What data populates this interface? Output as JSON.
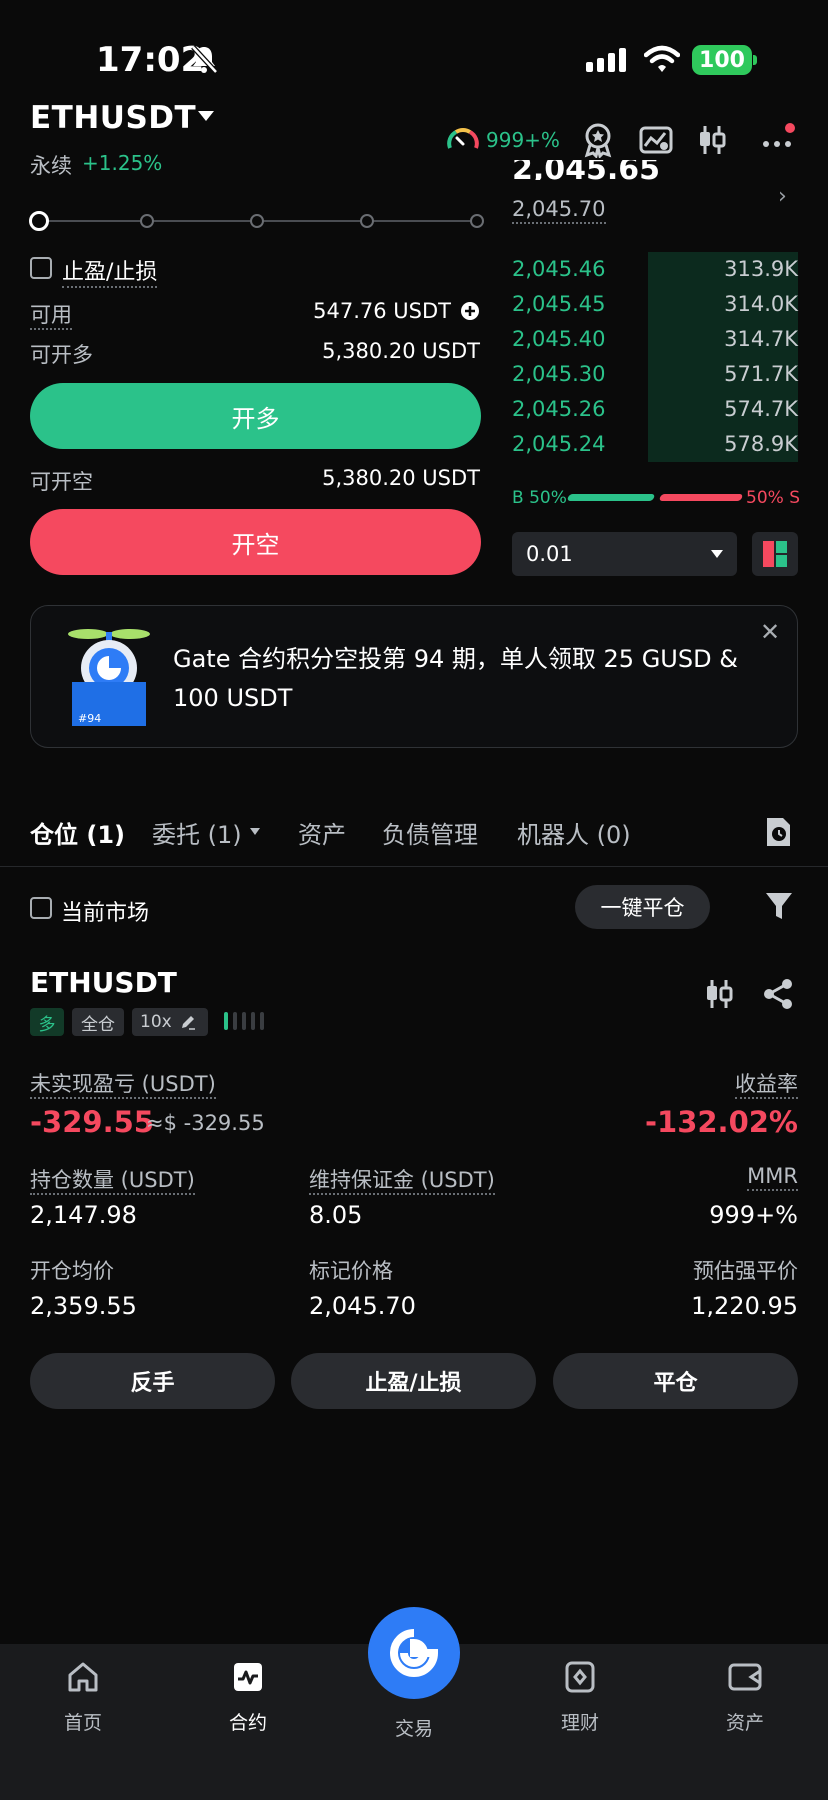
{
  "status": {
    "time": "17:02",
    "battery": "100"
  },
  "header": {
    "pair": "ETHUSDT",
    "contract_type": "永续",
    "change": "+1.25%",
    "risk_value": "999+%"
  },
  "order_form": {
    "tp_sl_label": "止盈/止损",
    "available_label": "可用",
    "available_value": "547.76 USDT",
    "can_long_label": "可开多",
    "can_long_value": "5,380.20 USDT",
    "long_button": "开多",
    "can_short_label": "可开空",
    "can_short_value": "5,380.20 USDT",
    "short_button": "开空"
  },
  "orderbook": {
    "last_price": "2,045.65",
    "mark_price": "2,045.70",
    "bids": [
      {
        "price": "2,045.46",
        "size": "313.9K"
      },
      {
        "price": "2,045.45",
        "size": "314.0K"
      },
      {
        "price": "2,045.40",
        "size": "314.7K"
      },
      {
        "price": "2,045.30",
        "size": "571.7K"
      },
      {
        "price": "2,045.26",
        "size": "574.7K"
      },
      {
        "price": "2,045.24",
        "size": "578.9K"
      }
    ],
    "buy_ratio": "B 50%",
    "sell_ratio": "50% S",
    "precision": "0.01"
  },
  "banner": {
    "text": "Gate 合约积分空投第 94 期，单人领取 25 GUSD & 100 USDT",
    "badge": "#94"
  },
  "tabs": [
    {
      "label": "仓位 (1)"
    },
    {
      "label": "委托 (1)"
    },
    {
      "label": "资产"
    },
    {
      "label": "负债管理"
    },
    {
      "label": "机器人 (0)"
    }
  ],
  "filters": {
    "current_market": "当前市场",
    "close_all": "一键平仓"
  },
  "position": {
    "symbol": "ETHUSDT",
    "side": "多",
    "margin_mode": "全仓",
    "leverage": "10x",
    "unrealized_pnl_label": "未实现盈亏 (USDT)",
    "unrealized_pnl": "-329.55",
    "unrealized_pnl_usd": "≈$ -329.55",
    "roe_label": "收益率",
    "roe": "-132.02%",
    "size_label": "持仓数量 (USDT)",
    "size": "2,147.98",
    "maint_margin_label": "维持保证金 (USDT)",
    "maint_margin": "8.05",
    "mmr_label": "MMR",
    "mmr": "999+%",
    "entry_label": "开仓均价",
    "entry": "2,359.55",
    "mark_label": "标记价格",
    "mark": "2,045.70",
    "liq_label": "预估强平价",
    "liq": "1,220.95",
    "reverse_button": "反手",
    "tpsl_button": "止盈/止损",
    "close_button": "平仓"
  },
  "nav": [
    {
      "label": "首页"
    },
    {
      "label": "合约"
    },
    {
      "label": "交易"
    },
    {
      "label": "理财"
    },
    {
      "label": "资产"
    }
  ],
  "colors": {
    "long": "#2bc28a",
    "short": "#f5495f",
    "liq": "#f3a46b",
    "accent": "#2e7cf6"
  }
}
